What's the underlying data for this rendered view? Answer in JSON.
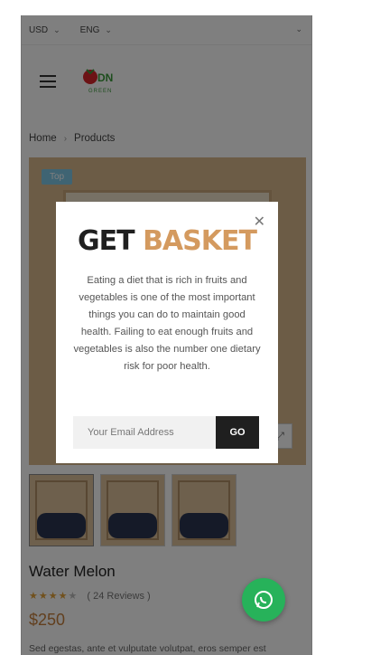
{
  "topbar": {
    "currency": "USD",
    "language": "ENG"
  },
  "header": {
    "logo_text": "DN",
    "logo_sub": "GREEN"
  },
  "breadcrumb": {
    "home": "Home",
    "current": "Products"
  },
  "product": {
    "badge": "Top",
    "title": "Water Melon",
    "rating": {
      "filled": 4,
      "total": 5,
      "reviews": "( 24 Reviews )"
    },
    "price": "$250",
    "description": "Sed egestas, ante et vulputate volutpat, eros semper est"
  },
  "popup": {
    "headline_word1": "GET",
    "headline_word2": "BASKET",
    "text": "Eating a diet that is rich in fruits and vegetables is one of the most important things you can do to maintain good health. Failing to eat enough fruits and vegetables is also the number one dietary risk for poor health.",
    "email_placeholder": "Your Email Address",
    "submit_label": "GO"
  },
  "colors": {
    "accent": "#d49a5f",
    "dark": "#1f1f1f",
    "whatsapp": "#27b25a",
    "badge": "#7fc8e6"
  },
  "icons": {
    "close": "close-icon",
    "menu": "hamburger-menu-icon",
    "whatsapp": "whatsapp-icon",
    "expand": "expand-icon"
  }
}
